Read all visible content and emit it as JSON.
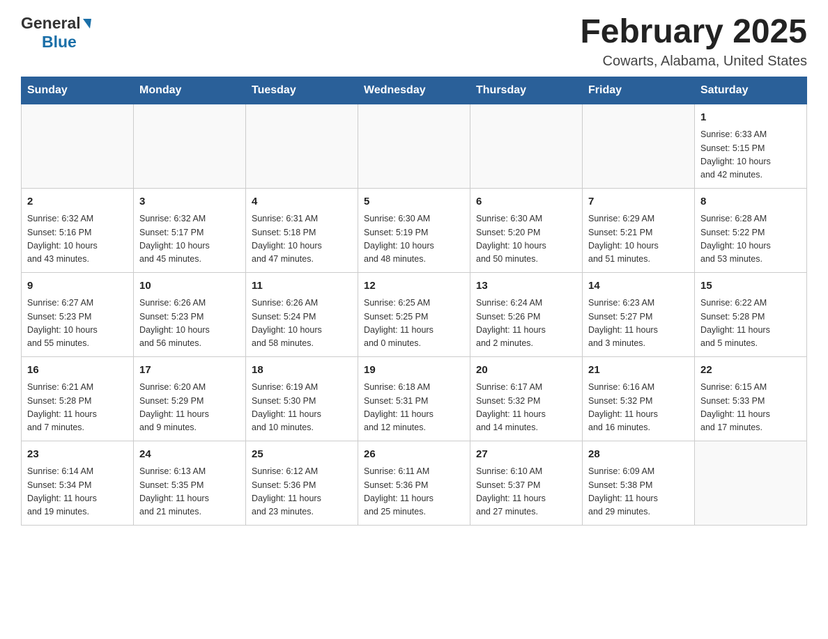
{
  "header": {
    "logo_general": "General",
    "logo_blue": "Blue",
    "title": "February 2025",
    "subtitle": "Cowarts, Alabama, United States"
  },
  "days_of_week": [
    "Sunday",
    "Monday",
    "Tuesday",
    "Wednesday",
    "Thursday",
    "Friday",
    "Saturday"
  ],
  "weeks": [
    [
      {
        "day": "",
        "info": ""
      },
      {
        "day": "",
        "info": ""
      },
      {
        "day": "",
        "info": ""
      },
      {
        "day": "",
        "info": ""
      },
      {
        "day": "",
        "info": ""
      },
      {
        "day": "",
        "info": ""
      },
      {
        "day": "1",
        "info": "Sunrise: 6:33 AM\nSunset: 5:15 PM\nDaylight: 10 hours\nand 42 minutes."
      }
    ],
    [
      {
        "day": "2",
        "info": "Sunrise: 6:32 AM\nSunset: 5:16 PM\nDaylight: 10 hours\nand 43 minutes."
      },
      {
        "day": "3",
        "info": "Sunrise: 6:32 AM\nSunset: 5:17 PM\nDaylight: 10 hours\nand 45 minutes."
      },
      {
        "day": "4",
        "info": "Sunrise: 6:31 AM\nSunset: 5:18 PM\nDaylight: 10 hours\nand 47 minutes."
      },
      {
        "day": "5",
        "info": "Sunrise: 6:30 AM\nSunset: 5:19 PM\nDaylight: 10 hours\nand 48 minutes."
      },
      {
        "day": "6",
        "info": "Sunrise: 6:30 AM\nSunset: 5:20 PM\nDaylight: 10 hours\nand 50 minutes."
      },
      {
        "day": "7",
        "info": "Sunrise: 6:29 AM\nSunset: 5:21 PM\nDaylight: 10 hours\nand 51 minutes."
      },
      {
        "day": "8",
        "info": "Sunrise: 6:28 AM\nSunset: 5:22 PM\nDaylight: 10 hours\nand 53 minutes."
      }
    ],
    [
      {
        "day": "9",
        "info": "Sunrise: 6:27 AM\nSunset: 5:23 PM\nDaylight: 10 hours\nand 55 minutes."
      },
      {
        "day": "10",
        "info": "Sunrise: 6:26 AM\nSunset: 5:23 PM\nDaylight: 10 hours\nand 56 minutes."
      },
      {
        "day": "11",
        "info": "Sunrise: 6:26 AM\nSunset: 5:24 PM\nDaylight: 10 hours\nand 58 minutes."
      },
      {
        "day": "12",
        "info": "Sunrise: 6:25 AM\nSunset: 5:25 PM\nDaylight: 11 hours\nand 0 minutes."
      },
      {
        "day": "13",
        "info": "Sunrise: 6:24 AM\nSunset: 5:26 PM\nDaylight: 11 hours\nand 2 minutes."
      },
      {
        "day": "14",
        "info": "Sunrise: 6:23 AM\nSunset: 5:27 PM\nDaylight: 11 hours\nand 3 minutes."
      },
      {
        "day": "15",
        "info": "Sunrise: 6:22 AM\nSunset: 5:28 PM\nDaylight: 11 hours\nand 5 minutes."
      }
    ],
    [
      {
        "day": "16",
        "info": "Sunrise: 6:21 AM\nSunset: 5:28 PM\nDaylight: 11 hours\nand 7 minutes."
      },
      {
        "day": "17",
        "info": "Sunrise: 6:20 AM\nSunset: 5:29 PM\nDaylight: 11 hours\nand 9 minutes."
      },
      {
        "day": "18",
        "info": "Sunrise: 6:19 AM\nSunset: 5:30 PM\nDaylight: 11 hours\nand 10 minutes."
      },
      {
        "day": "19",
        "info": "Sunrise: 6:18 AM\nSunset: 5:31 PM\nDaylight: 11 hours\nand 12 minutes."
      },
      {
        "day": "20",
        "info": "Sunrise: 6:17 AM\nSunset: 5:32 PM\nDaylight: 11 hours\nand 14 minutes."
      },
      {
        "day": "21",
        "info": "Sunrise: 6:16 AM\nSunset: 5:32 PM\nDaylight: 11 hours\nand 16 minutes."
      },
      {
        "day": "22",
        "info": "Sunrise: 6:15 AM\nSunset: 5:33 PM\nDaylight: 11 hours\nand 17 minutes."
      }
    ],
    [
      {
        "day": "23",
        "info": "Sunrise: 6:14 AM\nSunset: 5:34 PM\nDaylight: 11 hours\nand 19 minutes."
      },
      {
        "day": "24",
        "info": "Sunrise: 6:13 AM\nSunset: 5:35 PM\nDaylight: 11 hours\nand 21 minutes."
      },
      {
        "day": "25",
        "info": "Sunrise: 6:12 AM\nSunset: 5:36 PM\nDaylight: 11 hours\nand 23 minutes."
      },
      {
        "day": "26",
        "info": "Sunrise: 6:11 AM\nSunset: 5:36 PM\nDaylight: 11 hours\nand 25 minutes."
      },
      {
        "day": "27",
        "info": "Sunrise: 6:10 AM\nSunset: 5:37 PM\nDaylight: 11 hours\nand 27 minutes."
      },
      {
        "day": "28",
        "info": "Sunrise: 6:09 AM\nSunset: 5:38 PM\nDaylight: 11 hours\nand 29 minutes."
      },
      {
        "day": "",
        "info": ""
      }
    ]
  ]
}
